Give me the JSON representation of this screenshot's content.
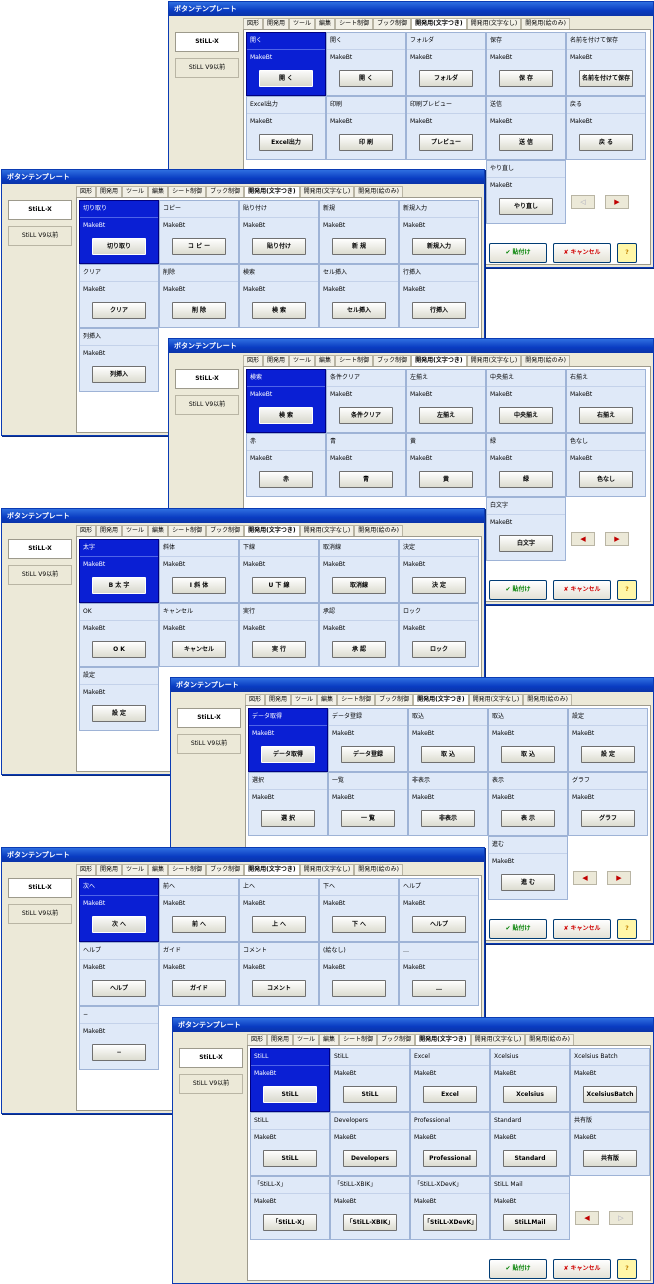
{
  "title": "ボタンテンプレート",
  "side_tabs": [
    "StiLL-X",
    "StiLL V9以前"
  ],
  "tabs": [
    "図形",
    "開発用",
    "ツール",
    "編集",
    "シート制御",
    "ブック制御",
    "開発用(文字つき)",
    "開発用(文字なし)",
    "開発用(絵のみ)"
  ],
  "footer": {
    "ok": "✔ 貼付け",
    "cancel": "✘ キャンセル",
    "help": "?"
  },
  "windows": [
    {
      "cells": [
        {
          "name": "開く",
          "mk": "MakeBt",
          "btn": "開 く"
        },
        {
          "name": "開く",
          "mk": "MakeBt",
          "btn": "開 く"
        },
        {
          "name": "フォルダ",
          "mk": "MakeBt",
          "btn": "フォルダ"
        },
        {
          "name": "保存",
          "mk": "MakeBt",
          "btn": "保 存"
        },
        {
          "name": "名前を付けて保存",
          "mk": "MakeBt",
          "btn": "名前を付けて保存"
        },
        {
          "name": "Excel出力",
          "mk": "MakeBt",
          "btn": "Excel出力"
        },
        {
          "name": "印刷",
          "mk": "MakeBt",
          "btn": "印 刷"
        },
        {
          "name": "印刷プレビュー",
          "mk": "MakeBt",
          "btn": "プレビュー"
        },
        {
          "name": "送信",
          "mk": "MakeBt",
          "btn": "送 信"
        },
        {
          "name": "戻る",
          "mk": "MakeBt",
          "btn": "戻 る"
        },
        {
          "name": "",
          "mk": "",
          "btn": ""
        },
        {
          "name": "",
          "mk": "",
          "btn": ""
        },
        {
          "name": "",
          "mk": "",
          "btn": ""
        },
        {
          "name": "やり直し",
          "mk": "MakeBt",
          "btn": "やり直し"
        }
      ]
    },
    {
      "cells": [
        {
          "name": "切り取り",
          "mk": "MakeBt",
          "btn": "切り取り"
        },
        {
          "name": "コピー",
          "mk": "MakeBt",
          "btn": "コ ピ ー"
        },
        {
          "name": "貼り付け",
          "mk": "MakeBt",
          "btn": "貼り付け"
        },
        {
          "name": "新規",
          "mk": "MakeBt",
          "btn": "新 規"
        },
        {
          "name": "新規入力",
          "mk": "MakeBt",
          "btn": "新規入力"
        },
        {
          "name": "クリア",
          "mk": "MakeBt",
          "btn": "クリア"
        },
        {
          "name": "削除",
          "mk": "MakeBt",
          "btn": "削 除"
        },
        {
          "name": "検索",
          "mk": "MakeBt",
          "btn": "検 索"
        },
        {
          "name": "セル挿入",
          "mk": "MakeBt",
          "btn": "セル挿入"
        },
        {
          "name": "行挿入",
          "mk": "MakeBt",
          "btn": "行挿入"
        },
        {
          "name": "列挿入",
          "mk": "MakeBt",
          "btn": "列挿入"
        }
      ]
    },
    {
      "cells": [
        {
          "name": "検索",
          "mk": "MakeBt",
          "btn": "検 索"
        },
        {
          "name": "条件クリア",
          "mk": "MakeBt",
          "btn": "条件クリア"
        },
        {
          "name": "左揃え",
          "mk": "MakeBt",
          "btn": "左揃え"
        },
        {
          "name": "中央揃え",
          "mk": "MakeBt",
          "btn": "中央揃え"
        },
        {
          "name": "右揃え",
          "mk": "MakeBt",
          "btn": "右揃え"
        },
        {
          "name": "赤",
          "mk": "MakeBt",
          "btn": "赤"
        },
        {
          "name": "青",
          "mk": "MakeBt",
          "btn": "青"
        },
        {
          "name": "黄",
          "mk": "MakeBt",
          "btn": "黄"
        },
        {
          "name": "緑",
          "mk": "MakeBt",
          "btn": "緑"
        },
        {
          "name": "色なし",
          "mk": "MakeBt",
          "btn": "色なし"
        },
        {
          "name": "",
          "mk": "",
          "btn": ""
        },
        {
          "name": "",
          "mk": "",
          "btn": ""
        },
        {
          "name": "",
          "mk": "",
          "btn": ""
        },
        {
          "name": "白文字",
          "mk": "MakeBt",
          "btn": "白文字"
        }
      ]
    },
    {
      "cells": [
        {
          "name": "太字",
          "mk": "MakeBt",
          "btn": "B 太 字"
        },
        {
          "name": "斜体",
          "mk": "MakeBt",
          "btn": "I 斜 体"
        },
        {
          "name": "下線",
          "mk": "MakeBt",
          "btn": "U 下 線"
        },
        {
          "name": "取消線",
          "mk": "MakeBt",
          "btn": "取消線"
        },
        {
          "name": "決定",
          "mk": "MakeBt",
          "btn": "決 定"
        },
        {
          "name": "OK",
          "mk": "MakeBt",
          "btn": "O K"
        },
        {
          "name": "キャンセル",
          "mk": "MakeBt",
          "btn": "キャンセル"
        },
        {
          "name": "実行",
          "mk": "MakeBt",
          "btn": "実 行"
        },
        {
          "name": "承認",
          "mk": "MakeBt",
          "btn": "承 認"
        },
        {
          "name": "ロック",
          "mk": "MakeBt",
          "btn": "ロック"
        },
        {
          "name": "設定",
          "mk": "MakeBt",
          "btn": "設 定"
        }
      ]
    },
    {
      "cells": [
        {
          "name": "データ取得",
          "mk": "MakeBt",
          "btn": "データ取得"
        },
        {
          "name": "データ登録",
          "mk": "MakeBt",
          "btn": "データ登録"
        },
        {
          "name": "取込",
          "mk": "MakeBt",
          "btn": "取 込"
        },
        {
          "name": "取込",
          "mk": "MakeBt",
          "btn": "取 込"
        },
        {
          "name": "設定",
          "mk": "MakeBt",
          "btn": "設 定"
        },
        {
          "name": "選択",
          "mk": "MakeBt",
          "btn": "選 択"
        },
        {
          "name": "一覧",
          "mk": "MakeBt",
          "btn": "一 覧"
        },
        {
          "name": "非表示",
          "mk": "MakeBt",
          "btn": "非表示"
        },
        {
          "name": "表示",
          "mk": "MakeBt",
          "btn": "表 示"
        },
        {
          "name": "グラフ",
          "mk": "MakeBt",
          "btn": "グラフ"
        },
        {
          "name": "",
          "mk": "",
          "btn": ""
        },
        {
          "name": "",
          "mk": "",
          "btn": ""
        },
        {
          "name": "",
          "mk": "",
          "btn": ""
        },
        {
          "name": "進む",
          "mk": "MakeBt",
          "btn": "進 む"
        }
      ]
    },
    {
      "cells": [
        {
          "name": "次へ",
          "mk": "MakeBt",
          "btn": "次 へ"
        },
        {
          "name": "前へ",
          "mk": "MakeBt",
          "btn": "前 へ"
        },
        {
          "name": "上へ",
          "mk": "MakeBt",
          "btn": "上 へ"
        },
        {
          "name": "下へ",
          "mk": "MakeBt",
          "btn": "下 へ"
        },
        {
          "name": "ヘルプ",
          "mk": "MakeBt",
          "btn": "ヘルプ"
        },
        {
          "name": "ヘルプ",
          "mk": "MakeBt",
          "btn": "ヘルプ"
        },
        {
          "name": "ガイド",
          "mk": "MakeBt",
          "btn": "ガイド"
        },
        {
          "name": "コメント",
          "mk": "MakeBt",
          "btn": "コメント"
        },
        {
          "name": "(絵なし)",
          "mk": "MakeBt",
          "btn": ""
        },
        {
          "name": "…",
          "mk": "MakeBt",
          "btn": "…"
        },
        {
          "name": "−",
          "mk": "MakeBt",
          "btn": "−"
        }
      ]
    },
    {
      "cells": [
        {
          "name": "StiLL",
          "mk": "MakeBt",
          "btn": "StiLL"
        },
        {
          "name": "StiLL",
          "mk": "MakeBt",
          "btn": "StiLL"
        },
        {
          "name": "Excel",
          "mk": "MakeBt",
          "btn": "Excel"
        },
        {
          "name": "Xcelsius",
          "mk": "MakeBt",
          "btn": "Xcelsius"
        },
        {
          "name": "Xcelsius Batch",
          "mk": "MakeBt",
          "btn": "XcelsiusBatch"
        },
        {
          "name": "StiLL",
          "mk": "MakeBt",
          "btn": "StiLL"
        },
        {
          "name": "Developers",
          "mk": "MakeBt",
          "btn": "Developers"
        },
        {
          "name": "Professional",
          "mk": "MakeBt",
          "btn": "Professional"
        },
        {
          "name": "Standard",
          "mk": "MakeBt",
          "btn": "Standard"
        },
        {
          "name": "共有版",
          "mk": "MakeBt",
          "btn": "共有版"
        },
        {
          "name": "「StiLL-X」",
          "mk": "MakeBt",
          "btn": "「StiLL-X」"
        },
        {
          "name": "「StiLL-XBIK」",
          "mk": "MakeBt",
          "btn": "「StiLL-XBIK」"
        },
        {
          "name": "「StiLL-XDevK」",
          "mk": "MakeBt",
          "btn": "「StiLL-XDevK」"
        },
        {
          "name": "StiLL Mail",
          "mk": "MakeBt",
          "btn": "StiLLMail"
        }
      ]
    }
  ]
}
